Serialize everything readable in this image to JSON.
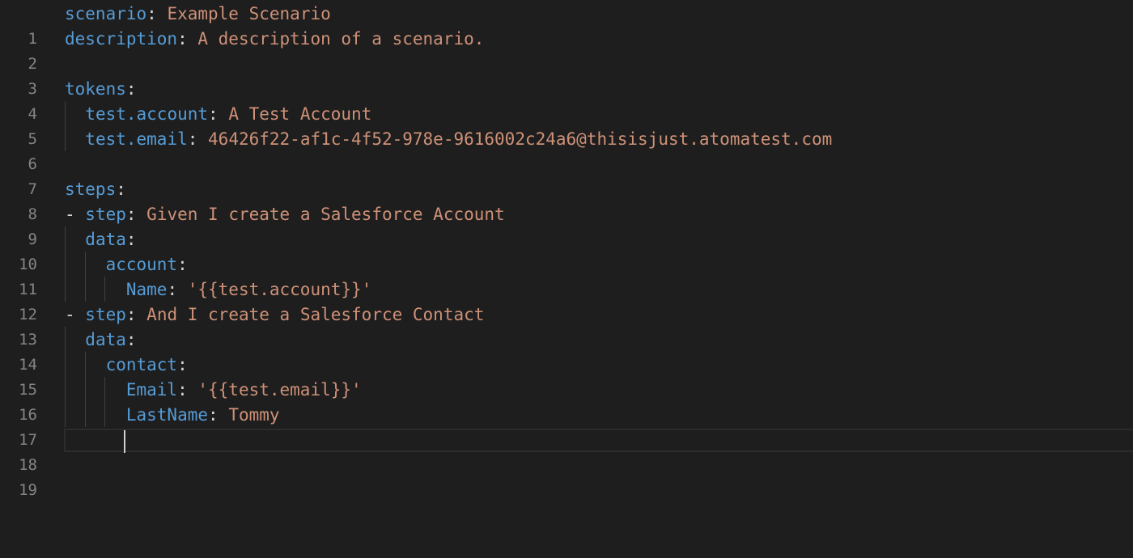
{
  "editor": {
    "lines": [
      {
        "num": "1",
        "key": "scenario",
        "sep": ": ",
        "val": "Example Scenario",
        "prefix": ""
      },
      {
        "num": "2",
        "key": "description",
        "sep": ": ",
        "val": "A description of a scenario.",
        "prefix": ""
      },
      {
        "num": "3",
        "key": "",
        "sep": "",
        "val": "",
        "prefix": ""
      },
      {
        "num": "4",
        "key": "tokens",
        "sep": ":",
        "val": "",
        "prefix": ""
      },
      {
        "num": "5",
        "key": "test.account",
        "sep": ": ",
        "val": "A Test Account",
        "prefix": "  "
      },
      {
        "num": "6",
        "key": "test.email",
        "sep": ": ",
        "val": "46426f22-af1c-4f52-978e-9616002c24a6@thisisjust.atomatest.com",
        "prefix": "  "
      },
      {
        "num": "7",
        "key": "",
        "sep": "",
        "val": "",
        "prefix": ""
      },
      {
        "num": "8",
        "key": "steps",
        "sep": ":",
        "val": "",
        "prefix": ""
      },
      {
        "num": "9",
        "key": "step",
        "sep": ": ",
        "val": "Given I create a Salesforce Account",
        "prefix": "- "
      },
      {
        "num": "10",
        "key": "data",
        "sep": ":",
        "val": "",
        "prefix": "  "
      },
      {
        "num": "11",
        "key": "account",
        "sep": ":",
        "val": "",
        "prefix": "    "
      },
      {
        "num": "12",
        "key": "Name",
        "sep": ": ",
        "val": "'{{test.account}}'",
        "prefix": "      "
      },
      {
        "num": "13",
        "key": "step",
        "sep": ": ",
        "val": "And I create a Salesforce Contact",
        "prefix": "- "
      },
      {
        "num": "14",
        "key": "data",
        "sep": ":",
        "val": "",
        "prefix": "  "
      },
      {
        "num": "15",
        "key": "contact",
        "sep": ":",
        "val": "",
        "prefix": "    "
      },
      {
        "num": "16",
        "key": "Email",
        "sep": ": ",
        "val": "'{{test.email}}'",
        "prefix": "      "
      },
      {
        "num": "17",
        "key": "LastName",
        "sep": ": ",
        "val": "Tommy",
        "prefix": "      "
      },
      {
        "num": "18",
        "key": "",
        "sep": "",
        "val": "",
        "prefix": ""
      },
      {
        "num": "19",
        "key": "",
        "sep": "",
        "val": "",
        "prefix": ""
      }
    ]
  },
  "colors": {
    "background": "#1e1e1e",
    "key": "#569cd6",
    "string": "#ce9178",
    "line_number": "#858585"
  }
}
